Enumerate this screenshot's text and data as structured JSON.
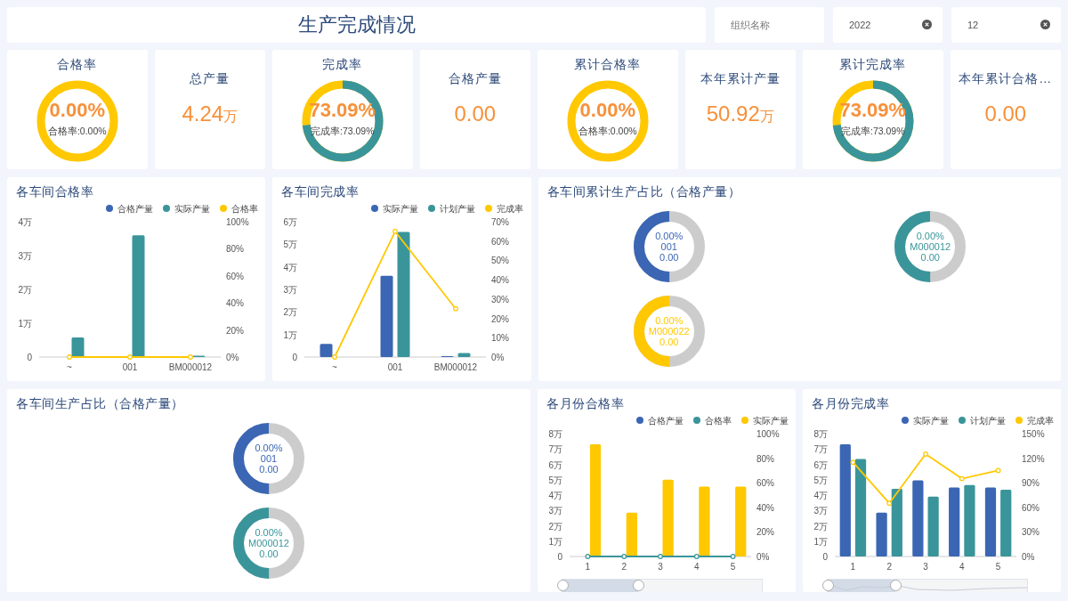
{
  "header": {
    "title": "生产完成情况"
  },
  "filters": [
    {
      "placeholder": "组织名称",
      "clearable": false
    },
    {
      "value": "2022",
      "clearable": true
    },
    {
      "value": "12",
      "clearable": true
    }
  ],
  "kpis": [
    {
      "kind": "gauge",
      "title": "合格率",
      "value": "0.00%",
      "caption": "合格率:0.00%",
      "level": 0
    },
    {
      "kind": "figure",
      "title": "总产量",
      "value": "4.24",
      "unit": "万"
    },
    {
      "kind": "gauge",
      "title": "完成率",
      "value": "73.09%",
      "caption": "完成率:73.09%",
      "level": 0.7309
    },
    {
      "kind": "figure",
      "title": "合格产量",
      "value": "0.00"
    },
    {
      "kind": "gauge",
      "title": "累计合格率",
      "value": "0.00%",
      "caption": "合格率:0.00%",
      "level": 0
    },
    {
      "kind": "figure",
      "title": "本年累计产量",
      "value": "50.92",
      "unit": "万"
    },
    {
      "kind": "gauge",
      "title": "累计完成率",
      "value": "73.09%",
      "caption": "完成率:73.09%",
      "level": 0.7309
    },
    {
      "kind": "figure",
      "title": "本年累计合格…",
      "value": "0.00"
    }
  ],
  "panels": [
    {
      "kind": "chart",
      "title": "各车间合格率",
      "chart_data": {
        "type": "bar",
        "categories": [
          "~",
          "001",
          "BM000012"
        ],
        "ylim": [
          0,
          4
        ],
        "yticks": [
          {
            "value": 0,
            "label": "0"
          },
          {
            "value": 1,
            "label": "1万"
          },
          {
            "value": 2,
            "label": "2万"
          },
          {
            "value": 3,
            "label": "3万"
          },
          {
            "value": 4,
            "label": "4万"
          }
        ],
        "y2lim": [
          0,
          100
        ],
        "y2ticks": [
          {
            "value": 0,
            "label": "0%"
          },
          {
            "value": 20,
            "label": "20%"
          },
          {
            "value": 40,
            "label": "40%"
          },
          {
            "value": 60,
            "label": "60%"
          },
          {
            "value": 80,
            "label": "80%"
          },
          {
            "value": 100,
            "label": "100%"
          }
        ],
        "series": [
          {
            "name": "合格产量",
            "type": "bar",
            "color": "#3b66b4",
            "values": [
              0,
              0,
              0
            ]
          },
          {
            "name": "实际产量",
            "type": "bar",
            "color": "#3a959b",
            "values": [
              0.58,
              3.6,
              0.04
            ]
          },
          {
            "name": "合格率",
            "type": "line",
            "axis": "y2",
            "marker": "circle",
            "color": "#ffc800",
            "values": [
              0,
              0,
              0
            ]
          }
        ],
        "legend": "top-right"
      }
    },
    {
      "kind": "chart",
      "title": "各车间完成率",
      "chart_data": {
        "type": "bar",
        "categories": [
          "~",
          "001",
          "BM000012"
        ],
        "ylim": [
          0,
          6
        ],
        "yticks": [
          {
            "value": 0,
            "label": "0"
          },
          {
            "value": 1,
            "label": "1万"
          },
          {
            "value": 2,
            "label": "2万"
          },
          {
            "value": 3,
            "label": "3万"
          },
          {
            "value": 4,
            "label": "4万"
          },
          {
            "value": 5,
            "label": "5万"
          },
          {
            "value": 6,
            "label": "6万"
          }
        ],
        "y2lim": [
          0,
          70
        ],
        "y2ticks": [
          {
            "value": 0,
            "label": "0%"
          },
          {
            "value": 10,
            "label": "10%"
          },
          {
            "value": 20,
            "label": "20%"
          },
          {
            "value": 30,
            "label": "30%"
          },
          {
            "value": 40,
            "label": "40%"
          },
          {
            "value": 50,
            "label": "50%"
          },
          {
            "value": 60,
            "label": "60%"
          },
          {
            "value": 70,
            "label": "70%"
          }
        ],
        "series": [
          {
            "name": "实际产量",
            "type": "bar",
            "color": "#3b66b4",
            "values": [
              0.58,
              3.6,
              0.04
            ]
          },
          {
            "name": "计划产量",
            "type": "bar",
            "color": "#3a959b",
            "values": [
              0,
              5.55,
              0.18
            ]
          },
          {
            "name": "完成率",
            "type": "line",
            "axis": "y2",
            "marker": "circle",
            "color": "#ffc800",
            "values": [
              0,
              65,
              25
            ]
          }
        ],
        "legend": "top-right"
      }
    },
    {
      "kind": "donuts",
      "title": "各车间累计生产占比（合格产量）",
      "items": [
        {
          "percent": "0.00%",
          "name": "001",
          "value": "0.00",
          "color": "#3b66b4",
          "level": 0.5
        },
        {
          "percent": "0.00%",
          "name": "M000012",
          "value": "0.00",
          "color": "#3a959b",
          "level": 0.5
        },
        {
          "percent": "0.00%",
          "name": "M000022",
          "value": "0.00",
          "color": "#ffc800",
          "level": 0.5
        }
      ]
    },
    {
      "kind": "donuts",
      "title": "各车间生产占比（合格产量）",
      "items": [
        {
          "percent": "0.00%",
          "name": "001",
          "value": "0.00",
          "color": "#3b66b4",
          "level": 0.5
        },
        {
          "percent": "0.00%",
          "name": "M000012",
          "value": "0.00",
          "color": "#3a959b",
          "level": 0.5
        }
      ]
    },
    {
      "kind": "chart",
      "title": "各月份合格率",
      "zoom_slider": {
        "level": 0.38
      },
      "chart_data": {
        "type": "bar",
        "categories": [
          "1",
          "2",
          "3",
          "4",
          "5"
        ],
        "ylim": [
          0,
          8
        ],
        "yticks": [
          {
            "value": 0,
            "label": "0"
          },
          {
            "value": 1,
            "label": "1万"
          },
          {
            "value": 2,
            "label": "2万"
          },
          {
            "value": 3,
            "label": "3万"
          },
          {
            "value": 4,
            "label": "4万"
          },
          {
            "value": 5,
            "label": "5万"
          },
          {
            "value": 6,
            "label": "6万"
          },
          {
            "value": 7,
            "label": "7万"
          },
          {
            "value": 8,
            "label": "8万"
          }
        ],
        "y2lim": [
          0,
          100
        ],
        "y2ticks": [
          {
            "value": 0,
            "label": "0%"
          },
          {
            "value": 20,
            "label": "20%"
          },
          {
            "value": 40,
            "label": "40%"
          },
          {
            "value": 60,
            "label": "60%"
          },
          {
            "value": 80,
            "label": "80%"
          },
          {
            "value": 100,
            "label": "100%"
          }
        ],
        "series": [
          {
            "name": "合格产量",
            "type": "bar",
            "color": "#3b66b4",
            "values": [
              0,
              0,
              0,
              0,
              0
            ]
          },
          {
            "name": "合格率",
            "type": "line",
            "axis": "y2",
            "marker": "circle",
            "color": "#3a959b",
            "values": [
              0,
              0,
              0,
              0,
              0
            ]
          },
          {
            "name": "实际产量",
            "type": "bar",
            "color": "#ffc800",
            "values": [
              7.3,
              2.85,
              5,
              4.55,
              4.55
            ]
          }
        ],
        "legend": "top-right"
      }
    },
    {
      "kind": "chart",
      "title": "各月份完成率",
      "zoom_slider": {
        "level": 0.34
      },
      "chart_data": {
        "type": "bar",
        "categories": [
          "1",
          "2",
          "3",
          "4",
          "5"
        ],
        "ylim": [
          0,
          8
        ],
        "yticks": [
          {
            "value": 0,
            "label": "0"
          },
          {
            "value": 1,
            "label": "1万"
          },
          {
            "value": 2,
            "label": "2万"
          },
          {
            "value": 3,
            "label": "3万"
          },
          {
            "value": 4,
            "label": "4万"
          },
          {
            "value": 5,
            "label": "5万"
          },
          {
            "value": 6,
            "label": "6万"
          },
          {
            "value": 7,
            "label": "7万"
          },
          {
            "value": 8,
            "label": "8万"
          }
        ],
        "y2lim": [
          0,
          150
        ],
        "y2ticks": [
          {
            "value": 0,
            "label": "0%"
          },
          {
            "value": 30,
            "label": "30%"
          },
          {
            "value": 60,
            "label": "60%"
          },
          {
            "value": 90,
            "label": "90%"
          },
          {
            "value": 120,
            "label": "120%"
          },
          {
            "value": 150,
            "label": "150%"
          }
        ],
        "series": [
          {
            "name": "实际产量",
            "type": "bar",
            "color": "#3b66b4",
            "values": [
              7.3,
              2.85,
              4.95,
              4.5,
              4.5
            ]
          },
          {
            "name": "计划产量",
            "type": "bar",
            "color": "#3a959b",
            "values": [
              6.35,
              4.4,
              3.9,
              4.65,
              4.35
            ]
          },
          {
            "name": "完成率",
            "type": "line",
            "axis": "y2",
            "marker": "circle",
            "color": "#ffc800",
            "values": [
              115,
              65,
              125,
              95,
              105
            ]
          }
        ],
        "legend": "top-right"
      }
    }
  ]
}
